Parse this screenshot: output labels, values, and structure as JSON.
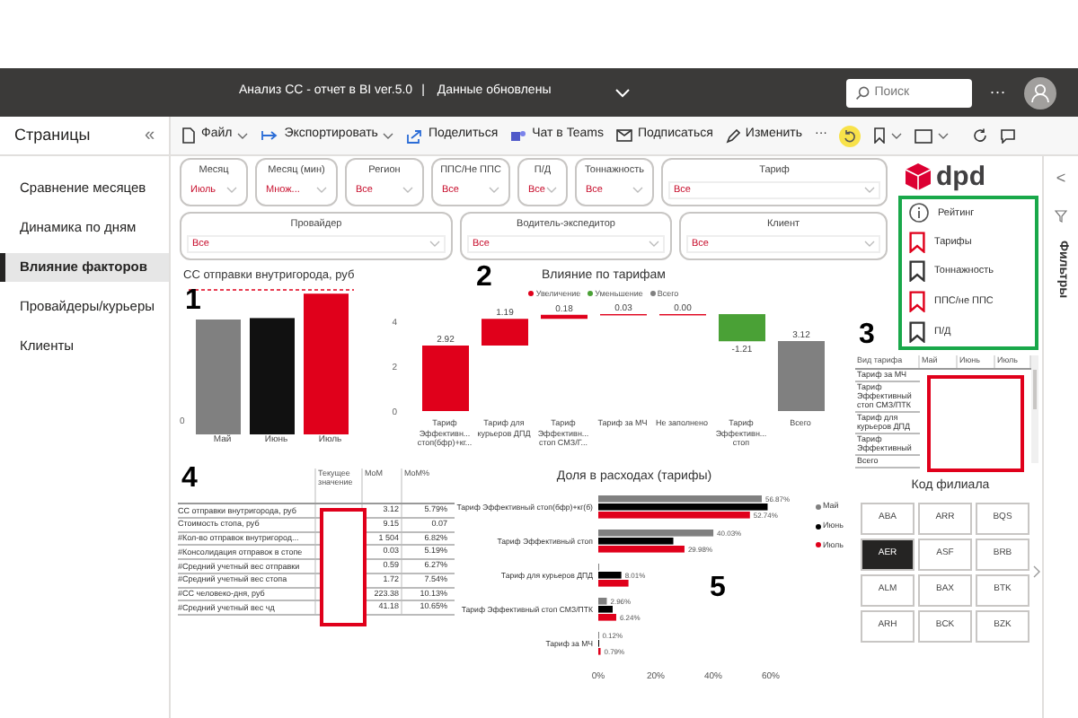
{
  "top_bar": {
    "title": "Анализ СС - отчет в BI ver.5.0",
    "separator": "|",
    "status": "Данные обновлены",
    "search": {
      "placeholder": "Поиск"
    },
    "more": "···"
  },
  "pages": {
    "title": "Страницы",
    "collapse": "«",
    "items": [
      {
        "label": "Сравнение месяцев",
        "selected": false
      },
      {
        "label": "Динамика по дням",
        "selected": false
      },
      {
        "label": "Влияние факторов",
        "selected": true
      },
      {
        "label": "Провайдеры/курьеры",
        "selected": false
      },
      {
        "label": "Клиенты",
        "selected": false
      }
    ]
  },
  "toolbar": [
    {
      "kind": "file",
      "label": "Файл",
      "dropdown": true
    },
    {
      "kind": "export",
      "label": "Экспортировать",
      "dropdown": true
    },
    {
      "kind": "share",
      "label": "Поделиться",
      "dropdown": false
    },
    {
      "kind": "teams",
      "label": "Чат в Teams",
      "dropdown": false
    },
    {
      "kind": "subscribe",
      "label": "Подписаться",
      "dropdown": false
    },
    {
      "kind": "edit",
      "label": "Изменить",
      "dropdown": false
    },
    {
      "kind": "more",
      "label": "···",
      "dropdown": false
    },
    {
      "kind": "undo",
      "dropdown": false
    },
    {
      "kind": "bookmark",
      "dropdown": true
    },
    {
      "kind": "view",
      "dropdown": true
    },
    {
      "kind": "refresh",
      "dropdown": false
    },
    {
      "kind": "comment",
      "dropdown": false
    }
  ],
  "filters": {
    "row_1": [
      {
        "label": "Месяц",
        "value": "Июль"
      },
      {
        "label": "Месяц (мин)",
        "value": "Множ..."
      },
      {
        "label": "Регион",
        "value": "Все"
      },
      {
        "label": "ППС/Не ППС",
        "value": "Все"
      },
      {
        "label": "П/Д",
        "value": "Все"
      },
      {
        "label": "Тоннажность",
        "value": "Все"
      },
      {
        "label": "Тариф",
        "value": "Все"
      }
    ],
    "row_2": [
      {
        "label": "Провайдер",
        "value": "Все"
      },
      {
        "label": "Водитель-экспедитор",
        "value": "Все"
      },
      {
        "label": "Клиент",
        "value": "Все"
      }
    ]
  },
  "cost_chart": {
    "title": "СС отправки внутригорода, руб",
    "y_tick": "0",
    "categories": [
      "Май",
      "Июнь",
      "Июль"
    ]
  },
  "tariff_impact": {
    "title": "Влияние по тарифам",
    "legend": [
      {
        "label": "Увеличение",
        "color": "#e0001b"
      },
      {
        "label": "Уменьшение",
        "color": "#4aa136"
      },
      {
        "label": "Всего",
        "color": "#808080"
      }
    ],
    "y_ticks": [
      "4",
      "2",
      "0"
    ],
    "bars": [
      {
        "kind": "increase",
        "label": "2.92",
        "category": "Тариф Эффективн... стоп(бфр)+кг..."
      },
      {
        "kind": "increase",
        "label": "1.19",
        "category": "Тариф для курьеров ДПД"
      },
      {
        "kind": "increase",
        "label": "0.18",
        "category": "Тариф Эффективн... стоп СМЗ/Г..."
      },
      {
        "kind": "increase",
        "label": "0.03",
        "category": "Тариф за МЧ"
      },
      {
        "kind": "increase",
        "label": "0.00",
        "category": "Не заполнено"
      },
      {
        "kind": "decrease",
        "label": "-1.21",
        "category": "Тариф Эффективн... стоп"
      },
      {
        "kind": "total",
        "label": "3.12",
        "category": "Всего"
      }
    ]
  },
  "tariff_table": {
    "columns": [
      "Вид тарифа",
      "Май",
      "Июнь",
      "Июль"
    ],
    "rows": [
      "Тариф за МЧ",
      "Тариф Эффективный стоп СМЗ/ПТК",
      "Тариф для курьеров ДПД",
      "Тариф Эффективный",
      "Всего"
    ]
  },
  "metrics_table": {
    "columns": [
      "Текущее значение",
      "MoM",
      "MoM%"
    ],
    "rows": [
      {
        "label": "СС отправки внутригорода, руб",
        "mom": "3.12",
        "mom_pct": "5.79%"
      },
      {
        "label": "Стоимость стопа, руб",
        "mom": "9.15",
        "mom_pct": "0.07"
      },
      {
        "label": "#Кол-во отправок внутригород...",
        "mom": "1 504",
        "mom_pct": "6.82%"
      },
      {
        "label": "#Консолидация отправок в стопе",
        "mom": "0.03",
        "mom_pct": "5.19%"
      },
      {
        "label": "#Средний учетный вес отправки",
        "mom": "0.59",
        "mom_pct": "6.27%"
      },
      {
        "label": "#Средний учетный вес стопа",
        "mom": "1.72",
        "mom_pct": "7.54%"
      },
      {
        "label": "#СС человеко-дня, руб",
        "mom": "223.38",
        "mom_pct": "10.13%"
      },
      {
        "label": "#Средний учетный вес чд",
        "mom": "41.18",
        "mom_pct": "10.65%"
      }
    ]
  },
  "cost_share": {
    "title": "Доля в расходах (тарифы)",
    "chart_data": {
      "type": "bar",
      "orientation": "horizontal",
      "categories": [
        "Тариф Эффективный стоп(бфр)+кг(б)",
        "Тариф Эффективный стоп",
        "Тариф для курьеров ДПД",
        "Тариф Эффективный стоп СМЗ/ПТК",
        "Тариф за МЧ"
      ],
      "series": [
        {
          "name": "Май",
          "color": "#808080",
          "values": [
            56.87,
            40.03,
            0,
            2.96,
            0.12
          ],
          "value_labels": [
            "56.87%",
            "40.03%",
            null,
            "2.96%",
            "0.12%"
          ]
        },
        {
          "name": "Июнь",
          "color": "#000000",
          "values": [
            58.9,
            26.1,
            8.01,
            5.0,
            0.3
          ],
          "value_labels": [
            null,
            null,
            "8.01%",
            null,
            null
          ]
        },
        {
          "name": "Июль",
          "color": "#e0001b",
          "values": [
            52.74,
            29.98,
            10.5,
            6.24,
            0.79
          ],
          "value_labels": [
            "52.74%",
            "29.98%",
            null,
            "6.24%",
            "0.79%"
          ]
        }
      ],
      "xlim": [
        0,
        60
      ],
      "xticks": [
        {
          "value": 0,
          "label": "0%"
        },
        {
          "value": 20,
          "label": "20%"
        },
        {
          "value": 40,
          "label": "40%"
        },
        {
          "value": 60,
          "label": "60%"
        }
      ]
    }
  },
  "logo": {
    "text": "dpd"
  },
  "bookmarks": [
    {
      "kind": "info",
      "label": "Рейтинг"
    },
    {
      "kind": "bookmark",
      "label": "Тарифы",
      "color": "#e0001b"
    },
    {
      "kind": "bookmark",
      "label": "Тоннажность",
      "color": "#333333"
    },
    {
      "kind": "bookmark",
      "label": "ППС/не ППС",
      "color": "#e0001b"
    },
    {
      "kind": "bookmark",
      "label": "П/Д",
      "color": "#333333"
    }
  ],
  "branches": {
    "title": "Код филиала",
    "items": [
      {
        "label": "ABA",
        "selected": false
      },
      {
        "label": "ARR",
        "selected": false
      },
      {
        "label": "BQS",
        "selected": false
      },
      {
        "label": "AER",
        "selected": true
      },
      {
        "label": "ASF",
        "selected": false
      },
      {
        "label": "BRB",
        "selected": false
      },
      {
        "label": "ALM",
        "selected": false
      },
      {
        "label": "BAX",
        "selected": false
      },
      {
        "label": "BTK",
        "selected": false
      },
      {
        "label": "ARH",
        "selected": false
      },
      {
        "label": "BCK",
        "selected": false
      },
      {
        "label": "BZK",
        "selected": false
      }
    ]
  },
  "filters_pane": {
    "collapse": "<",
    "title": "Фильтры"
  },
  "callouts": [
    "1",
    "2",
    "3",
    "4",
    "5"
  ]
}
